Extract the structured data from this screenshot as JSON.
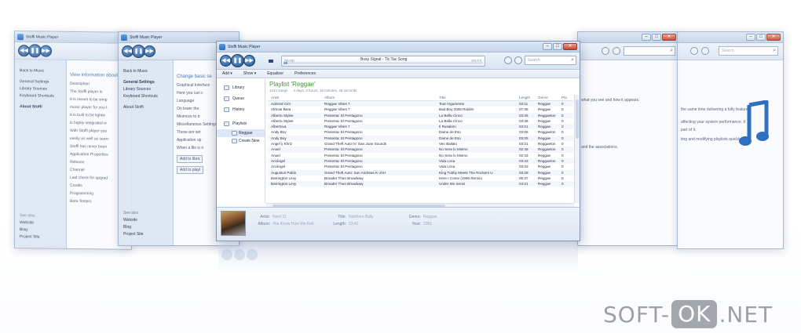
{
  "app": {
    "title": "Stoffi Music Player"
  },
  "caption": {
    "min": "–",
    "max": "□",
    "close": "✕"
  },
  "left_far": {
    "nav": [
      "Back to Music",
      "General Settings",
      "Library Sources",
      "Keyboard Shortcuts",
      "About Stoffi"
    ],
    "body_title": "View information about",
    "body_lines": [
      "Description",
      "The Stoffi player is",
      "It is meant to be simp",
      "music player for you t",
      "It is built to be lightw",
      "is highly integrated w",
      "With Stoffi player you",
      "easily as well as searc",
      "Stoffi has never been",
      "Application Properties",
      "Release",
      "Channel",
      "Last check for upgrad",
      "Credits",
      "Programming",
      "Beta Testers"
    ],
    "see_also": "See also",
    "links": [
      "Website",
      "Blog",
      "Project Site"
    ]
  },
  "left_mid": {
    "nav": [
      "Back to Music",
      "General Settings",
      "Library Sources",
      "Keyboard Shortcuts",
      "About Stoffi"
    ],
    "body_title": "Change basic se",
    "body_lines": [
      "Graphical Interface",
      "Here you can c",
      "Language",
      "On lower the",
      "Minimize to tr",
      "Miscellaneous Settings",
      "These are set",
      "Application up",
      "When a file is o",
      "Add to libra",
      "Add to playl"
    ],
    "see_also": "See also",
    "links": [
      "Website",
      "Blog",
      "Project Site"
    ]
  },
  "right_mid": {
    "lines": [
      "what you see and how it appears.",
      "and the associations."
    ]
  },
  "right_far": {
    "search_placeholder": "Search",
    "lines": [
      "the same time delivering a fully featured",
      "affecting your system performance. It",
      "part of it.",
      "ting and modifying playlists quickly and"
    ]
  },
  "main": {
    "transport": {
      "prev": "◀◀",
      "play": "❚❚",
      "next": "▶▶"
    },
    "now_playing": {
      "current_time": "00:00",
      "song": "Busy Signal - Tic Tac Song",
      "total_time": "03:13",
      "progress": 0.02
    },
    "search_placeholder": "Search",
    "menu": [
      "Add ▾",
      "Show ▾",
      "Equalizer",
      "Preferences"
    ],
    "library": {
      "items": [
        {
          "label": "Library"
        },
        {
          "label": "Queue"
        },
        {
          "label": "History"
        }
      ],
      "playlists_label": "Playlists",
      "playlists": [
        {
          "label": "Reggae"
        },
        {
          "label": "Create New"
        }
      ]
    },
    "playlist": {
      "title": "Playlist 'Reggae'",
      "count": "1314 songs",
      "duration": "4 days, 3 hours, 16 minutes, 46 seconds"
    },
    "columns": {
      "artist": "Artist",
      "album": "Album",
      "title": "Title",
      "length": "Length",
      "genre": "Genre",
      "plays": "Pla"
    },
    "rows": [
      [
        "Admiral Cim",
        "Reggae Vibes 7",
        "Tout Argumente",
        "03:11",
        "Reggae",
        "0"
      ],
      [
        "African Beat",
        "Reggae Vibes 7",
        "Bad Boy 2008 Riddim",
        "07:38",
        "Reggae",
        "0"
      ],
      [
        "Alberto Stylee",
        "Presenta: El Pentagono",
        "La Bella Cinco",
        "03:36",
        "Reggaeton",
        "0"
      ],
      [
        "Alberto Stylee",
        "Presenta: El Pentagono",
        "La Bella Cinco",
        "03:36",
        "Reggae",
        "0"
      ],
      [
        "Albertova",
        "Reggae Vibes 7",
        "Il Rusalem",
        "04:01",
        "Reggae",
        "0"
      ],
      [
        "Andy Boy",
        "Presenta: El Pentagono",
        "Dame de Eso",
        "03:05",
        "Reggaeton",
        "0"
      ],
      [
        "Andy Boy",
        "Presenta: El Pentagono",
        "Dame de Eso",
        "03:05",
        "Reggae",
        "0"
      ],
      [
        "Angel y Khriz",
        "Grand Theft Auto IV: San Juan Sounds",
        "Ven Bailalo",
        "03:21",
        "Reggaeton",
        "0"
      ],
      [
        "Anuel",
        "Presenta: El Pentagono",
        "No Sera lo Mismo",
        "02:49",
        "Reggaeton",
        "0"
      ],
      [
        "Anuel",
        "Presenta: El Pentagono",
        "No Sera lo Mismo",
        "02:43",
        "Reggae",
        "0"
      ],
      [
        "Arcángel",
        "Presenta: El Pentagono",
        "Vida Loca",
        "03:43",
        "Reggaeton",
        "0"
      ],
      [
        "Arcángel",
        "Presenta: El Pentagono",
        "Vida Loca",
        "03:43",
        "Reggae",
        "0"
      ],
      [
        "Augustus Pablo",
        "Grand Theft Auto: San Andreas K-JAH",
        "King Tubby Meets The Rockers U",
        "03:28",
        "Reggae",
        "0"
      ],
      [
        "Barrington Levy",
        "Broader Than Broadway",
        "Here I Come (1990 Remix)",
        "05:37",
        "Reggae",
        "0"
      ],
      [
        "Barrington Levy",
        "Broader Than Broadway",
        "Under Me Sensi",
        "04:21",
        "Reggae",
        "0"
      ]
    ],
    "details": {
      "artist_label": "Artist:",
      "artist": "Nord 21",
      "album_label": "Album:",
      "album": "You Know How We Roll",
      "title_label": "Title:",
      "title": "Northern Bally",
      "length_label": "Length:",
      "length": "03:42",
      "genre_label": "Genre:",
      "genre": "Reggae",
      "year_label": "Year:",
      "year": "2001"
    }
  },
  "watermark": {
    "part1": "SOFT-",
    "part2": "OK",
    "part3": ".NET"
  },
  "colors": {
    "accent": "#3c9a2f",
    "chrome": "#c4d5ea",
    "button": "#1f4f8c"
  }
}
